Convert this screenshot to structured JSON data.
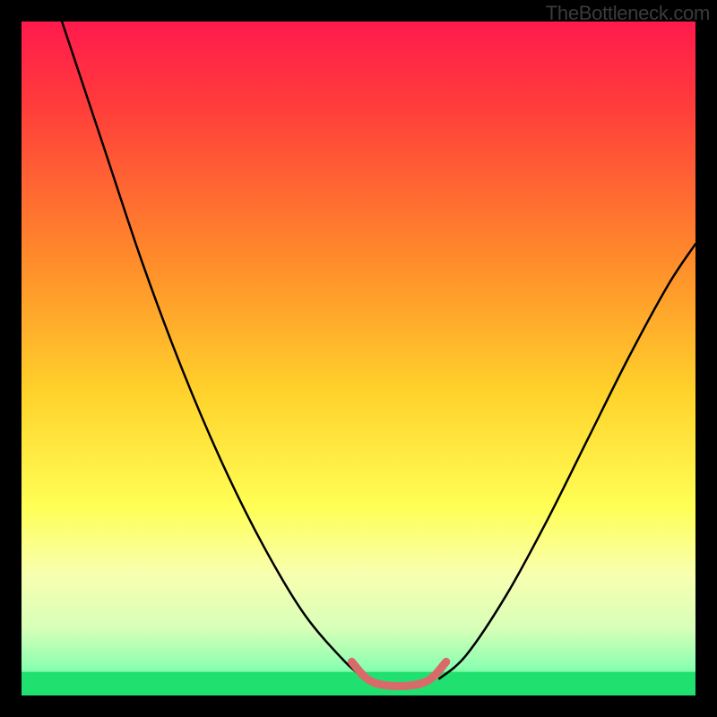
{
  "watermark": "TheBottleneck.com",
  "chart_data": {
    "type": "line",
    "title": "",
    "xlabel": "",
    "ylabel": "",
    "xlim": [
      0,
      100
    ],
    "ylim": [
      0,
      100
    ],
    "gradient_stops": [
      {
        "offset": 0,
        "color": "#ff1a4d"
      },
      {
        "offset": 12,
        "color": "#ff3b3b"
      },
      {
        "offset": 35,
        "color": "#ff8a2b"
      },
      {
        "offset": 55,
        "color": "#ffd22b"
      },
      {
        "offset": 72,
        "color": "#ffff55"
      },
      {
        "offset": 82,
        "color": "#f8ffb0"
      },
      {
        "offset": 90,
        "color": "#d8ffb8"
      },
      {
        "offset": 96,
        "color": "#8affb0"
      },
      {
        "offset": 100,
        "color": "#20e070"
      }
    ],
    "series": [
      {
        "name": "curve-left",
        "type": "line",
        "color": "#000000",
        "points": [
          {
            "x": 6,
            "y": 100
          },
          {
            "x": 12,
            "y": 82
          },
          {
            "x": 18,
            "y": 64
          },
          {
            "x": 24,
            "y": 48
          },
          {
            "x": 30,
            "y": 34
          },
          {
            "x": 36,
            "y": 22
          },
          {
            "x": 42,
            "y": 12
          },
          {
            "x": 48,
            "y": 5
          },
          {
            "x": 51,
            "y": 2.5
          }
        ]
      },
      {
        "name": "curve-right",
        "type": "line",
        "color": "#000000",
        "points": [
          {
            "x": 62,
            "y": 2.5
          },
          {
            "x": 66,
            "y": 6
          },
          {
            "x": 72,
            "y": 15
          },
          {
            "x": 78,
            "y": 26
          },
          {
            "x": 84,
            "y": 38
          },
          {
            "x": 90,
            "y": 50
          },
          {
            "x": 96,
            "y": 61
          },
          {
            "x": 100,
            "y": 67
          }
        ]
      },
      {
        "name": "valley-highlight",
        "type": "line",
        "color": "#d96a6a",
        "stroke_width": 9,
        "points": [
          {
            "x": 49,
            "y": 5
          },
          {
            "x": 51,
            "y": 2.7
          },
          {
            "x": 53,
            "y": 1.7
          },
          {
            "x": 56,
            "y": 1.4
          },
          {
            "x": 59,
            "y": 1.7
          },
          {
            "x": 61,
            "y": 2.7
          },
          {
            "x": 63,
            "y": 5
          }
        ]
      }
    ]
  }
}
